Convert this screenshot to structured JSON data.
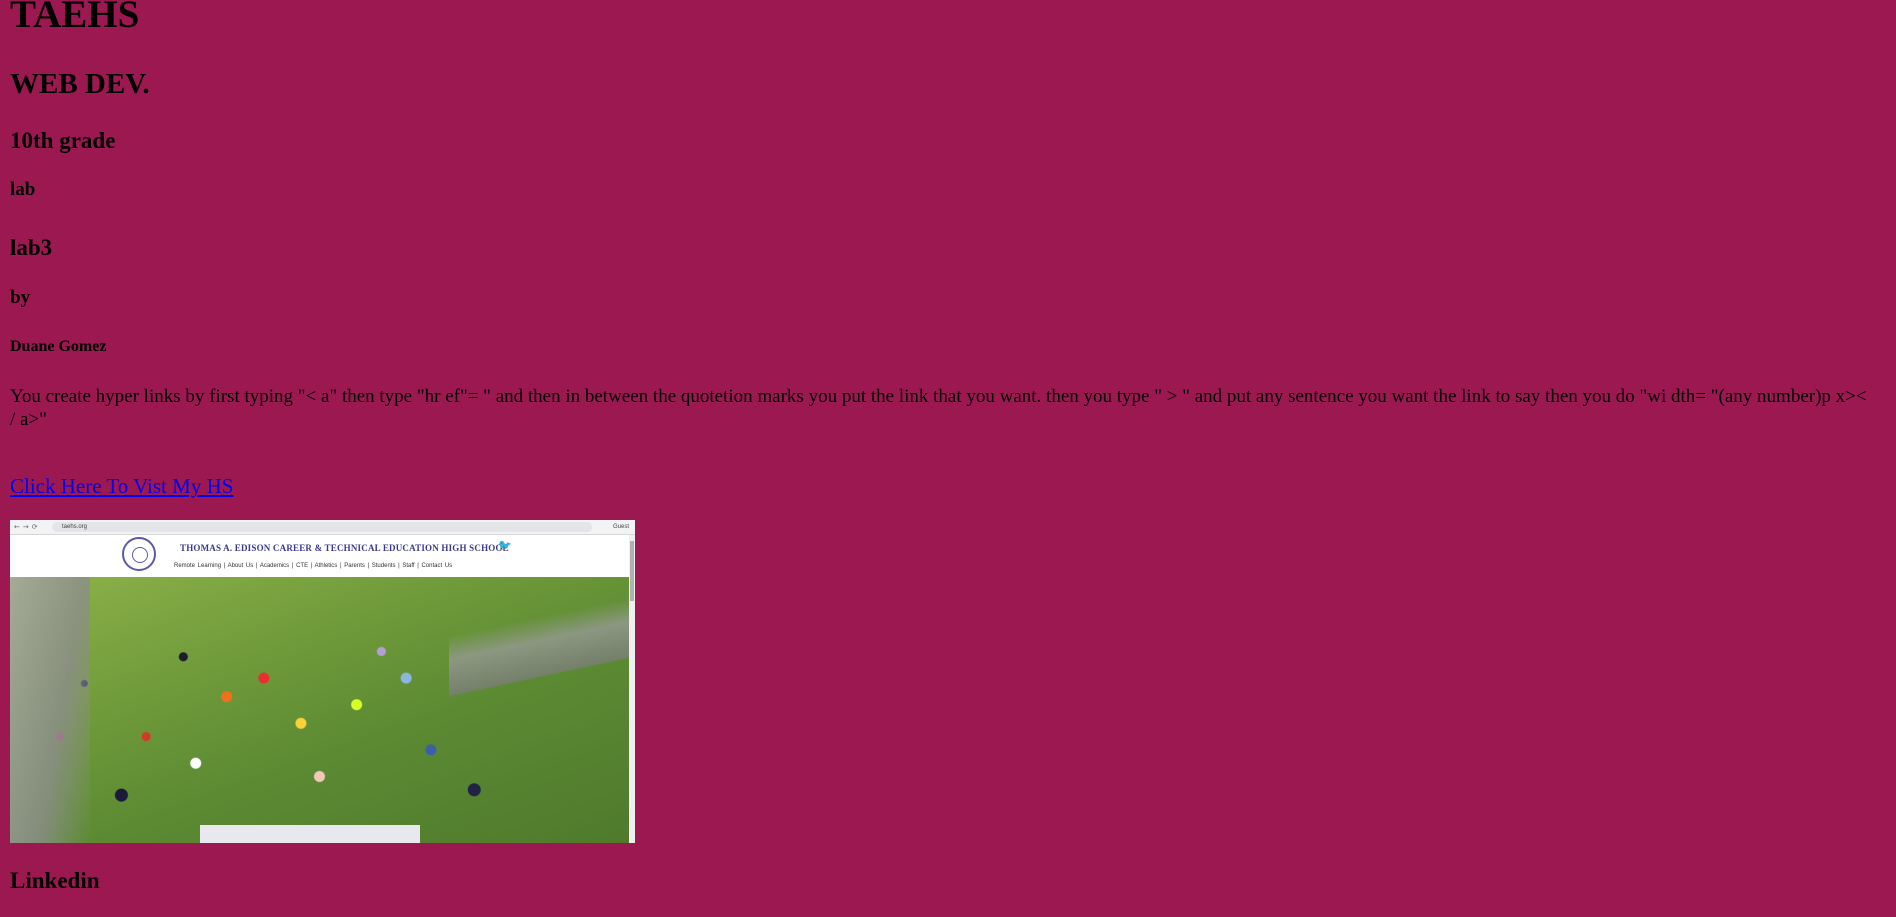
{
  "page": {
    "background_color": "#9c1850",
    "link_color": "#0000ee"
  },
  "headings": {
    "school": "TAEHS",
    "course": "WEB DEV.",
    "grade": "10th grade",
    "lab_label": "lab",
    "lab_name": "lab3",
    "by_label": "by",
    "author": "Duane Gomez"
  },
  "instructions": "You create hyper links by first typing \"< a\" then type \"hr ef\"= \" and then in between the quotetion marks you put the link that you want. then you type \" > \" and put any sentence you want the link to say then you do \"wi dth= \"(any number)p x>< / a>\"",
  "link": {
    "label": "Click Here To Vist My HS"
  },
  "screenshot": {
    "url": "taehs.org",
    "guest_label": "Guest",
    "school_name": "THOMAS A. EDISON CAREER & TECHNICAL EDUCATION HIGH SCHOOL",
    "menu": "Remote Learning | About Us | Academics | CTE | Athletics | Parents | Students | Staff | Contact Us",
    "icons": [
      "school-seal-icon",
      "twitter-icon"
    ]
  },
  "footer_heading": "Linkedin"
}
